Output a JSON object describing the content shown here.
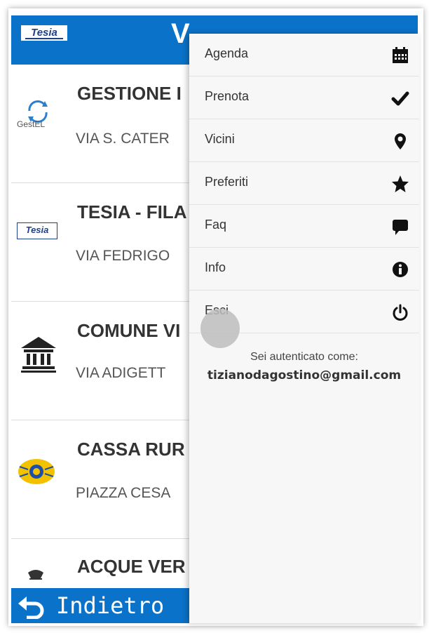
{
  "header": {
    "logo": "Tesia",
    "title": "V"
  },
  "list": [
    {
      "name": "GESTIONE I",
      "address": "VIA S. CATER",
      "icon": "gestel-logo-icon",
      "icon_text": "GestEL"
    },
    {
      "name": "TESIA - FILA",
      "address": "VIA FEDRIGO",
      "icon": "tesia-logo-icon",
      "icon_text": "Tesia"
    },
    {
      "name": "COMUNE VI",
      "address": "VIA ADIGETT",
      "icon": "town-hall-icon"
    },
    {
      "name": "CASSA RUR",
      "address": "PIAZZA CESA",
      "icon": "bank-logo-icon"
    },
    {
      "name": "ACQUE VER",
      "address": "",
      "icon": "water-company-icon"
    }
  ],
  "footer": {
    "back_label": "Indietro"
  },
  "menu": {
    "items": [
      {
        "label": "Agenda",
        "icon": "calendar-icon"
      },
      {
        "label": "Prenota",
        "icon": "checkmark-icon"
      },
      {
        "label": "Vicini",
        "icon": "map-pin-icon"
      },
      {
        "label": "Preferiti",
        "icon": "star-icon"
      },
      {
        "label": "Faq",
        "icon": "speech-bubble-icon"
      },
      {
        "label": "Info",
        "icon": "info-icon"
      },
      {
        "label": "Esci",
        "icon": "power-icon"
      }
    ],
    "auth_label": "Sei autenticato come:",
    "auth_email": "tizianodagostino@gmail.com"
  },
  "colors": {
    "primary": "#0b72c9",
    "menu_bg": "#f7f7f7"
  }
}
